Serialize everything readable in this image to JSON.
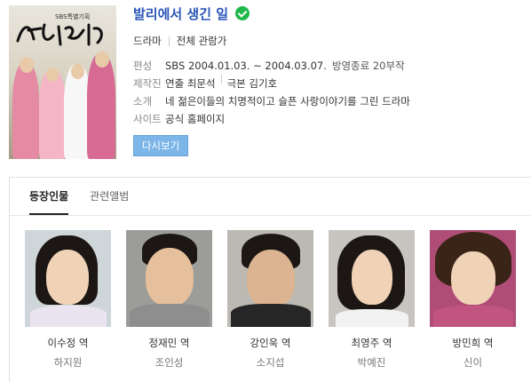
{
  "drama": {
    "title": "발리에서 생긴 일",
    "verified_icon": "check-circle-icon",
    "genre": "드라마",
    "rating": "전체 관람가",
    "poster_text": "발리에서 생긴 일",
    "poster_tag": "SBS특별기획"
  },
  "info": {
    "broadcast_label": "편성",
    "broadcast_value": "SBS 2004.01.03. ~ 2004.03.07.",
    "broadcast_status": "방영종료 20부작",
    "staff_label": "제작진",
    "director": "연출 최문석",
    "writer": "극본 김기호",
    "intro_label": "소개",
    "intro_value": "네 젊은이들의 치명적이고 슬픈 사랑이야기를 그린 드라마",
    "site_label": "사이트",
    "site_value": "공식 홈페이지"
  },
  "replay_button": "다시보기",
  "tabs": [
    "등장인물",
    "관련앨범"
  ],
  "cast": [
    {
      "role": "이수정 역",
      "actor": "하지원"
    },
    {
      "role": "정재민 역",
      "actor": "조인성"
    },
    {
      "role": "강인욱 역",
      "actor": "소지섭"
    },
    {
      "role": "최영주 역",
      "actor": "박예진"
    },
    {
      "role": "방민희 역",
      "actor": "신이"
    }
  ],
  "colors": {
    "title": "#2a55b8",
    "check": "#1fb84a",
    "replay_button": "#7cb5e7"
  }
}
